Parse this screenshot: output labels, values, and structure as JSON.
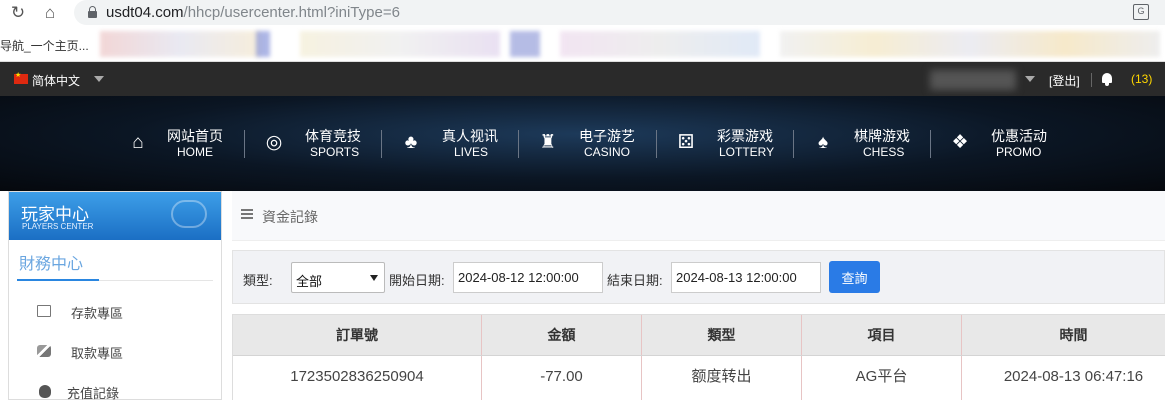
{
  "browser": {
    "url_host": "usdt04.com",
    "url_path": "/hhcp/usercenter.html?iniType=6",
    "bookmark_text": "导航_一个主页..."
  },
  "topbar": {
    "language": "简体中文",
    "logout": "[登出]",
    "message_count": "(13)"
  },
  "nav": [
    {
      "zh": "网站首页",
      "en": "HOME",
      "icon": "home-icon"
    },
    {
      "zh": "体育竞技",
      "en": "SPORTS",
      "icon": "ball-icon"
    },
    {
      "zh": "真人视讯",
      "en": "LIVES",
      "icon": "cards-icon"
    },
    {
      "zh": "电子游艺",
      "en": "CASINO",
      "icon": "slot-icon"
    },
    {
      "zh": "彩票游戏",
      "en": "LOTTERY",
      "icon": "dice-icon"
    },
    {
      "zh": "棋牌游戏",
      "en": "CHESS",
      "icon": "spade-icon"
    },
    {
      "zh": "优惠活动",
      "en": "PROMO",
      "icon": "gift-icon"
    }
  ],
  "sidebar": {
    "title_zh": "玩家中心",
    "title_en": "PLAYERS CENTER",
    "section": "財務中心",
    "items": [
      {
        "label": "存款專區",
        "icon": "deposit-icon"
      },
      {
        "label": "取款專區",
        "icon": "withdraw-icon"
      },
      {
        "label": "充值記錄",
        "icon": "moneybag-icon"
      }
    ]
  },
  "main": {
    "title": "資金記錄",
    "filter": {
      "type_label": "類型:",
      "type_value": "全部",
      "start_label": "開始日期:",
      "start_value": "2024-08-12 12:00:00",
      "end_label": "結束日期:",
      "end_value": "2024-08-13 12:00:00",
      "query_button": "查詢"
    },
    "table": {
      "headers": [
        "訂單號",
        "金額",
        "類型",
        "項目",
        "時間"
      ],
      "rows": [
        [
          "1723502836250904",
          "-77.00",
          "额度转出",
          "AG平台",
          "2024-08-13 06:47:16"
        ]
      ]
    }
  },
  "colors": {
    "accent": "#2a7be6",
    "topbar_bg": "#2a2a2a",
    "sidebar_header": "#1b6fc4"
  }
}
